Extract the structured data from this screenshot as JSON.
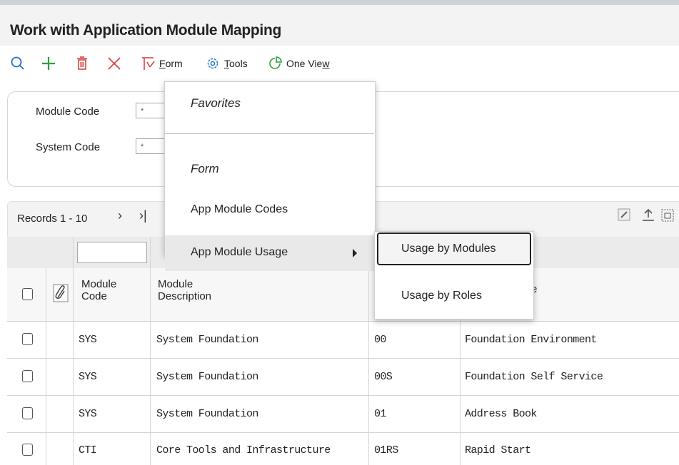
{
  "page": {
    "title": "Work with Application Module Mapping"
  },
  "toolbar": {
    "form_label_first": "F",
    "form_label_rest": "orm",
    "tools_label_first": "T",
    "tools_label_rest": "ools",
    "oneview_label_first": "One Vie",
    "oneview_label_rest": "w",
    "colors": {
      "search": "#1a73c9",
      "add": "#2e9e3e",
      "delete": "#d64545",
      "cancel": "#d64545",
      "form": "#d64545",
      "tools": "#1a73c9",
      "oneview": "#2e9e3e"
    }
  },
  "filters": {
    "module_code_label": "Module Code",
    "module_code_value": "*",
    "system_code_label": "System Code",
    "system_code_value": "*"
  },
  "grid": {
    "records_label": "Records 1 - 10",
    "next_glyph": "›",
    "last_glyph": "›|",
    "columns": {
      "module_code_line1": "Module",
      "module_code_line2": "Code",
      "module_desc_line1": "Module",
      "module_desc_line2": "Description",
      "col4_visible": "e"
    },
    "rows": [
      {
        "module_code": "SYS",
        "module_desc": "System Foundation",
        "system_code": "00",
        "system_desc": "Foundation Environment"
      },
      {
        "module_code": "SYS",
        "module_desc": "System Foundation",
        "system_code": "00S",
        "system_desc": "Foundation Self Service"
      },
      {
        "module_code": "SYS",
        "module_desc": "System Foundation",
        "system_code": "01",
        "system_desc": "Address Book"
      },
      {
        "module_code": "CTI",
        "module_desc": "Core Tools and Infrastructure",
        "system_code": "01RS",
        "system_desc": "Rapid Start"
      }
    ]
  },
  "form_menu": {
    "favorites_label": "Favorites",
    "form_label": "Form",
    "app_module_codes": "App Module Codes",
    "app_module_usage": "App Module Usage"
  },
  "submenu": {
    "usage_by_modules": "Usage by Modules",
    "usage_by_roles": "Usage by Roles"
  }
}
